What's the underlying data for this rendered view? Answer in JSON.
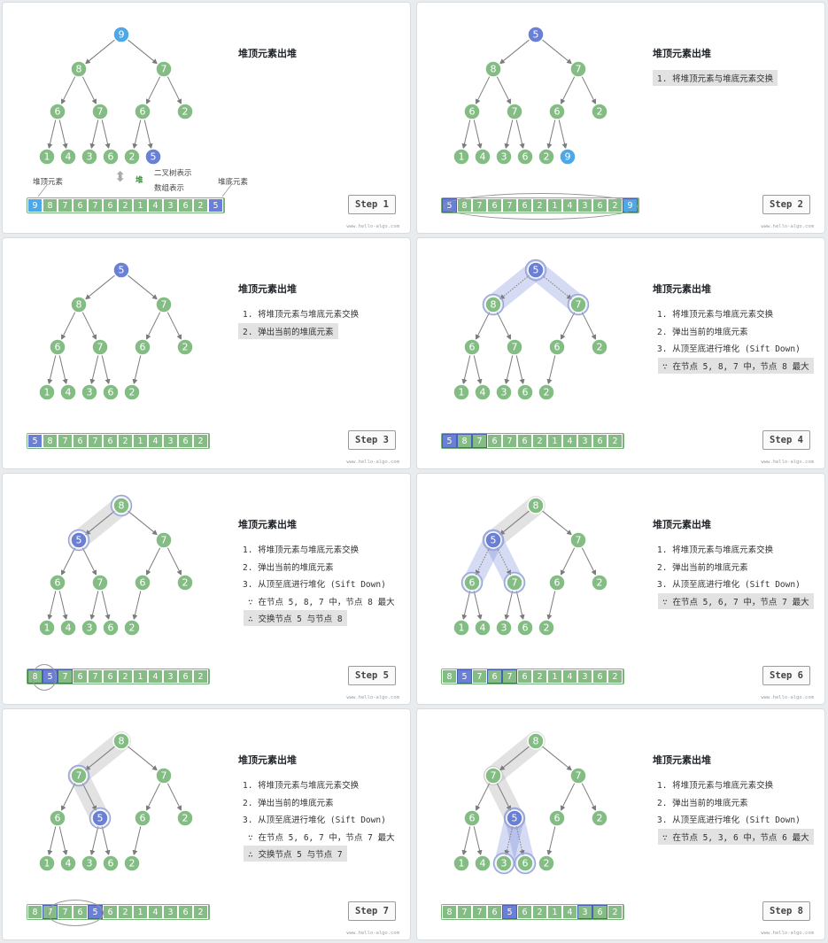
{
  "colors": {
    "green": "#84bd84",
    "blue": "#4ea7e6",
    "purple": "#6a7fd6",
    "edge": "#7c7c7c",
    "highlight": "#c9d1f0"
  },
  "watermark": "www.hello-algo.com",
  "panels": [
    {
      "step": "Step 1",
      "title": "堆顶元素出堆",
      "lines": [],
      "tree": [
        9,
        8,
        7,
        6,
        7,
        6,
        2,
        1,
        4,
        3,
        6,
        2,
        5
      ],
      "arr": [
        9,
        8,
        7,
        6,
        7,
        6,
        2,
        1,
        4,
        3,
        6,
        2,
        5
      ],
      "nodeColors": {
        "0": "blue",
        "12": "purple"
      },
      "labels": {
        "top": "堆顶元素",
        "bottom": "堆底元素",
        "heap": "堆",
        "tree": "二叉树表示",
        "array": "数组表示"
      }
    },
    {
      "step": "Step 2",
      "title": "堆顶元素出堆",
      "lines": [
        {
          "t": "1. 将堆顶元素与堆底元素交换",
          "hl": true
        }
      ],
      "tree": [
        5,
        8,
        7,
        6,
        7,
        6,
        2,
        1,
        4,
        3,
        6,
        2,
        9
      ],
      "arr": [
        5,
        8,
        7,
        6,
        7,
        6,
        2,
        1,
        4,
        3,
        6,
        2,
        9
      ],
      "nodeColors": {
        "0": "purple",
        "12": "blue"
      }
    },
    {
      "step": "Step 3",
      "title": "堆顶元素出堆",
      "lines": [
        {
          "t": "1. 将堆顶元素与堆底元素交换",
          "hl": false
        },
        {
          "t": "2. 弹出当前的堆底元素",
          "hl": true
        }
      ],
      "tree": [
        5,
        8,
        7,
        6,
        7,
        6,
        2,
        1,
        4,
        3,
        6,
        2
      ],
      "arr": [
        5,
        8,
        7,
        6,
        7,
        6,
        2,
        1,
        4,
        3,
        6,
        2
      ],
      "nodeColors": {
        "0": "purple"
      }
    },
    {
      "step": "Step 4",
      "title": "堆顶元素出堆",
      "lines": [
        {
          "t": "1. 将堆顶元素与堆底元素交换",
          "hl": false
        },
        {
          "t": "2. 弹出当前的堆底元素",
          "hl": false
        },
        {
          "t": "3. 从顶至底进行堆化 (Sift Down)",
          "hl": false
        },
        {
          "t": "∵ 在节点 5, 8, 7 中，节点 8 最大",
          "hl": true
        }
      ],
      "tree": [
        5,
        8,
        7,
        6,
        7,
        6,
        2,
        1,
        4,
        3,
        6,
        2
      ],
      "arr": [
        5,
        8,
        7,
        6,
        7,
        6,
        2,
        1,
        4,
        3,
        6,
        2
      ],
      "nodeColors": {
        "0": "purple"
      }
    },
    {
      "step": "Step 5",
      "title": "堆顶元素出堆",
      "lines": [
        {
          "t": "1. 将堆顶元素与堆底元素交换",
          "hl": false
        },
        {
          "t": "2. 弹出当前的堆底元素",
          "hl": false
        },
        {
          "t": "3. 从顶至底进行堆化 (Sift Down)",
          "hl": false
        },
        {
          "t": "∵ 在节点 5, 8, 7 中，节点 8 最大",
          "hl": false
        },
        {
          "t": "∴ 交换节点 5 与节点 8",
          "hl": true
        }
      ],
      "tree": [
        8,
        5,
        7,
        6,
        7,
        6,
        2,
        1,
        4,
        3,
        6,
        2
      ],
      "arr": [
        8,
        5,
        7,
        6,
        7,
        6,
        2,
        1,
        4,
        3,
        6,
        2
      ],
      "nodeColors": {
        "1": "purple"
      }
    },
    {
      "step": "Step 6",
      "title": "堆顶元素出堆",
      "lines": [
        {
          "t": "1. 将堆顶元素与堆底元素交换",
          "hl": false
        },
        {
          "t": "2. 弹出当前的堆底元素",
          "hl": false
        },
        {
          "t": "3. 从顶至底进行堆化 (Sift Down)",
          "hl": false
        },
        {
          "t": "∵ 在节点 5, 6, 7 中，节点 7 最大",
          "hl": true
        }
      ],
      "tree": [
        8,
        5,
        7,
        6,
        7,
        6,
        2,
        1,
        4,
        3,
        6,
        2
      ],
      "arr": [
        8,
        5,
        7,
        6,
        7,
        6,
        2,
        1,
        4,
        3,
        6,
        2
      ],
      "nodeColors": {
        "1": "purple"
      }
    },
    {
      "step": "Step 7",
      "title": "堆顶元素出堆",
      "lines": [
        {
          "t": "1. 将堆顶元素与堆底元素交换",
          "hl": false
        },
        {
          "t": "2. 弹出当前的堆底元素",
          "hl": false
        },
        {
          "t": "3. 从顶至底进行堆化 (Sift Down)",
          "hl": false
        },
        {
          "t": "∵ 在节点 5, 6, 7 中，节点 7 最大",
          "hl": false
        },
        {
          "t": "∴ 交换节点 5 与节点 7",
          "hl": true
        }
      ],
      "tree": [
        8,
        7,
        7,
        6,
        5,
        6,
        2,
        1,
        4,
        3,
        6,
        2
      ],
      "arr": [
        8,
        7,
        7,
        6,
        5,
        6,
        2,
        1,
        4,
        3,
        6,
        2
      ],
      "nodeColors": {
        "4": "purple"
      }
    },
    {
      "step": "Step 8",
      "title": "堆顶元素出堆",
      "lines": [
        {
          "t": "1. 将堆顶元素与堆底元素交换",
          "hl": false
        },
        {
          "t": "2. 弹出当前的堆底元素",
          "hl": false
        },
        {
          "t": "3. 从顶至底进行堆化 (Sift Down)",
          "hl": false
        },
        {
          "t": "∵ 在节点 5, 3, 6 中，节点 6 最大",
          "hl": true
        }
      ],
      "tree": [
        8,
        7,
        7,
        6,
        5,
        6,
        2,
        1,
        4,
        3,
        6,
        2
      ],
      "arr": [
        8,
        7,
        7,
        6,
        5,
        6,
        2,
        1,
        4,
        3,
        6,
        2
      ],
      "nodeColors": {
        "4": "purple"
      }
    }
  ]
}
